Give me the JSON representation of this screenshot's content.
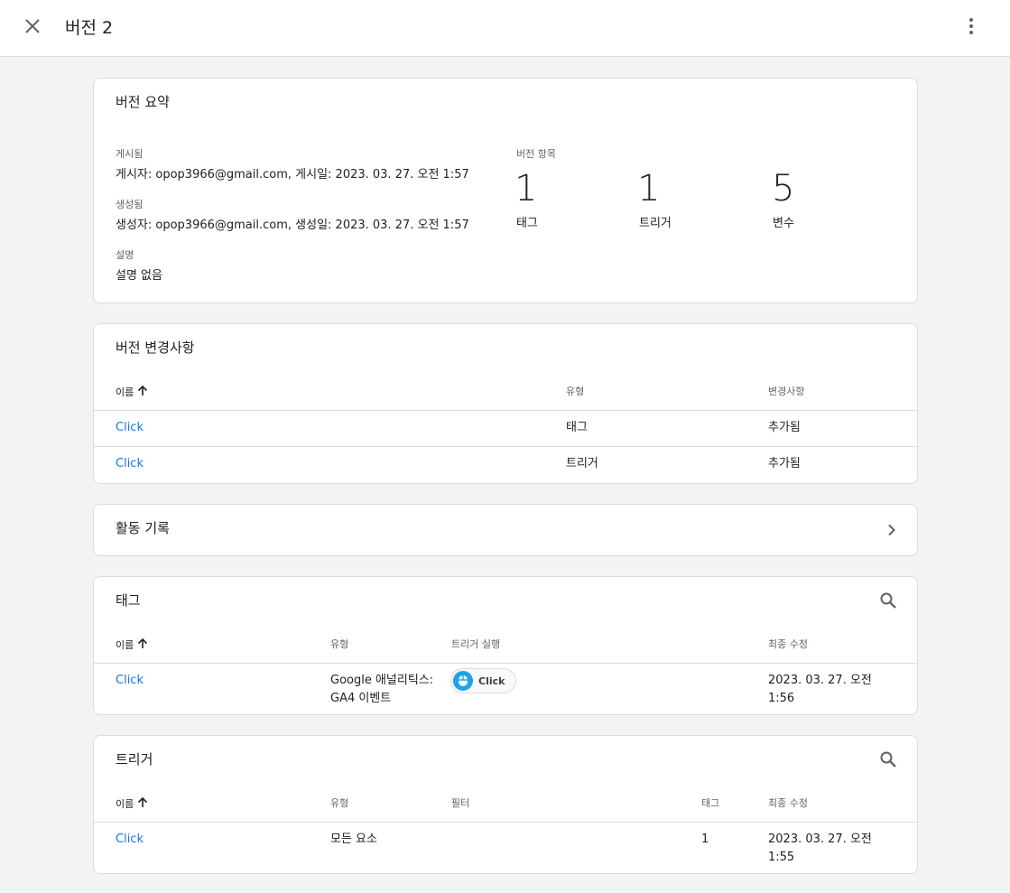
{
  "header": {
    "title": "버전 2",
    "close_icon": "close-icon",
    "more_icon": "more-vert-icon"
  },
  "summary": {
    "title": "버전 요약",
    "published_label": "게시됨",
    "published_value": "게시자: opop3966@gmail.com, 게시일: 2023. 03. 27. 오전 1:57",
    "created_label": "생성됨",
    "created_value": "생성자: opop3966@gmail.com, 생성일: 2023. 03. 27. 오전 1:57",
    "description_label": "설명",
    "description_value": "설명 없음",
    "items_label": "버전 항목",
    "stats": [
      {
        "count": "1",
        "label": "태그"
      },
      {
        "count": "1",
        "label": "트리거"
      },
      {
        "count": "5",
        "label": "변수"
      }
    ]
  },
  "changes": {
    "title": "버전 변경사항",
    "headers": {
      "name": "이름",
      "type": "유형",
      "change": "변경사항"
    },
    "rows": [
      {
        "name": "Click",
        "type": "태그",
        "change": "추가됨"
      },
      {
        "name": "Click",
        "type": "트리거",
        "change": "추가됨"
      }
    ]
  },
  "activity": {
    "title": "활동 기록"
  },
  "tags": {
    "title": "태그",
    "headers": {
      "name": "이름",
      "type": "유형",
      "firing": "트리거 실행",
      "modified": "최종 수정"
    },
    "rows": [
      {
        "name": "Click",
        "type_line1": "Google 애널리틱스:",
        "type_line2": "GA4 이벤트",
        "trigger_chip": "Click",
        "modified_line1": "2023. 03. 27. 오전",
        "modified_line2": "1:56"
      }
    ]
  },
  "triggers": {
    "title": "트리거",
    "headers": {
      "name": "이름",
      "type": "유형",
      "filter": "필터",
      "tags": "태그",
      "modified": "최종 수정"
    },
    "rows": [
      {
        "name": "Click",
        "type": "모든 요소",
        "tags": "1",
        "modified_line1": "2023. 03. 27. 오전",
        "modified_line2": "1:55"
      }
    ]
  },
  "colors": {
    "link": "#1a73e8",
    "chip_icon": "#1fa3ec",
    "background": "#f1f3f4"
  }
}
